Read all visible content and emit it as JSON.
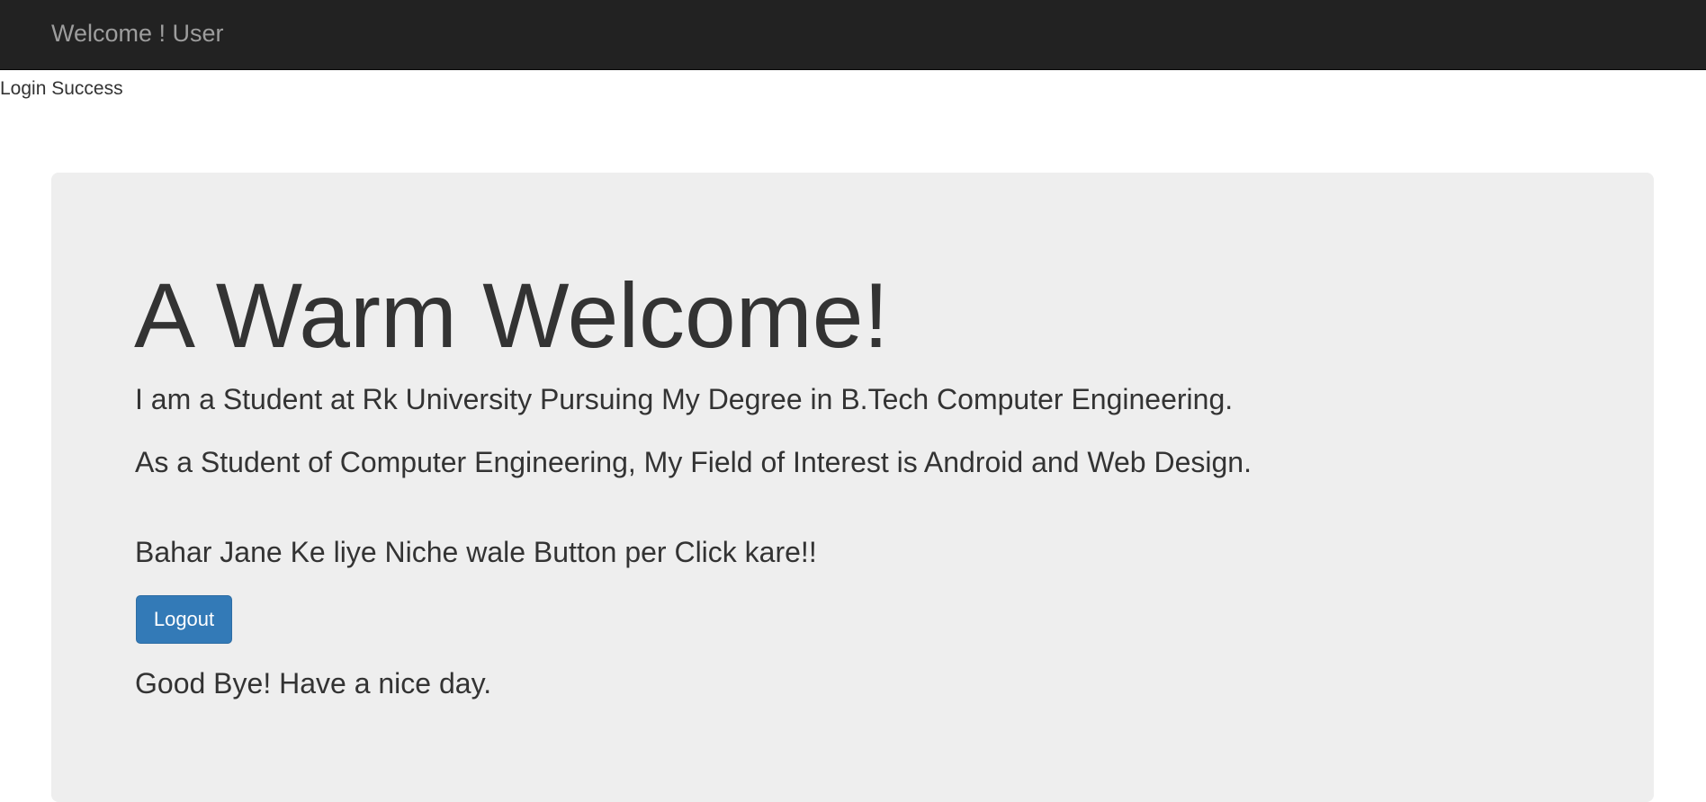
{
  "navbar": {
    "brand": "Welcome ! User"
  },
  "status": {
    "message": "Login Success"
  },
  "jumbotron": {
    "heading": "A Warm Welcome!",
    "paragraph_1": "I am a Student at Rk University Pursuing My Degree in B.Tech Computer Engineering.",
    "paragraph_2": "As a Student of Computer Engineering, My Field of Interest is Android and Web Design.",
    "paragraph_3": "Bahar Jane Ke liye Niche wale Button per Click kare!!",
    "logout_label": "Logout",
    "farewell": "Good Bye! Have a nice day."
  },
  "colors": {
    "navbar_bg": "#222222",
    "navbar_text": "#9d9d9d",
    "jumbotron_bg": "#eeeeee",
    "button_primary": "#337ab7",
    "text": "#333333"
  }
}
